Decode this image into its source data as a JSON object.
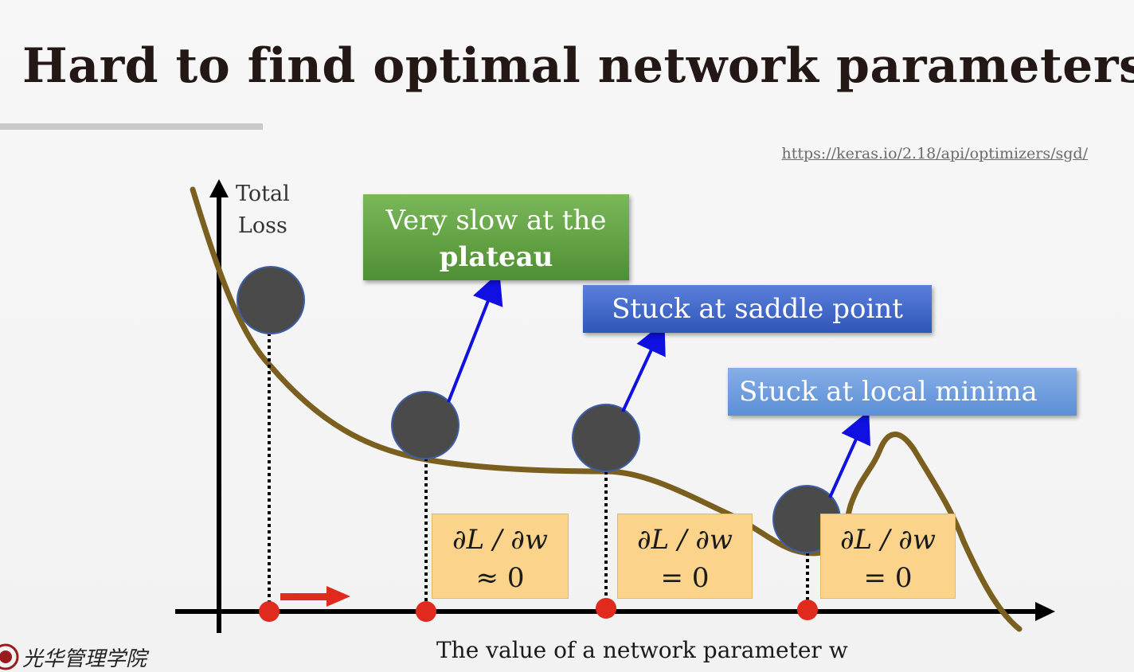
{
  "title": "Hard to find optimal network parameters",
  "reference_link": "https://keras.io/2.18/api/optimizers/sgd/",
  "axes": {
    "y_label_line1": "Total",
    "y_label_line2": "Loss",
    "x_label": "The value of a network parameter w"
  },
  "callouts": {
    "plateau_line1": "Very slow at the",
    "plateau_line2": "plateau",
    "saddle": "Stuck at saddle point",
    "local": "Stuck at local minima"
  },
  "gradients": [
    {
      "expr": "∂L / ∂w",
      "value": "≈ 0"
    },
    {
      "expr": "∂L / ∂w",
      "value": "= 0"
    },
    {
      "expr": "∂L / ∂w",
      "value": "= 0"
    }
  ],
  "logo": {
    "icon": "school-seal-icon",
    "text": "光华管理学院"
  },
  "colors": {
    "curve": "#7a5f1e",
    "ball": "#4a4a4a",
    "ball_border": "#3c5fa8",
    "point": "#e02a1e",
    "arrow_blue": "#1010e0",
    "arrow_red": "#e02a1e",
    "plateau_box": "#5a9a3c",
    "saddle_box": "#3a62c4",
    "local_box": "#6a9ade",
    "gradient_box": "#fbd38a"
  }
}
